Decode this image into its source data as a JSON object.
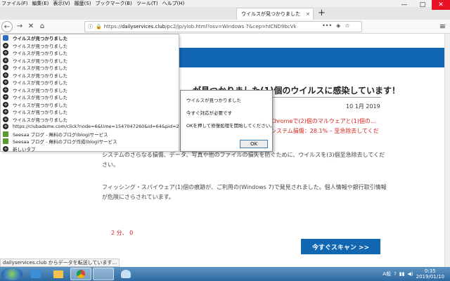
{
  "menubar": [
    "ファイル(F)",
    "編集(E)",
    "表示(V)",
    "履歴(S)",
    "ブックマーク(B)",
    "ツール(T)",
    "ヘルプ(H)"
  ],
  "tab": {
    "title": "ウイルスが見つかりました",
    "close": "×",
    "new": "+"
  },
  "window_controls": {
    "minimize": "—",
    "maximize": "□",
    "close": "✕"
  },
  "nav": {
    "back": "←",
    "forward": "→",
    "stop": "✕",
    "home": "⌂",
    "url_scheme": "https://",
    "url_domain": "dailyservices.club",
    "url_path": "/pc2/jp/ylob.html?osv=Windows 7&cep=hICND9bcVk",
    "menu": "≡"
  },
  "dropdown": {
    "items": [
      {
        "icon": "shield",
        "label": "ウイルスが見つかりました"
      },
      {
        "icon": "plus",
        "label": "ウイルスが見つかりました"
      },
      {
        "icon": "plus",
        "label": "ウイルスが見つかりました"
      },
      {
        "icon": "plus",
        "label": "ウイルスが見つかりました"
      },
      {
        "icon": "plus",
        "label": "ウイルスが見つかりました"
      },
      {
        "icon": "plus",
        "label": "ウイルスが見つかりました"
      },
      {
        "icon": "plus",
        "label": "ウイルスが見つかりました"
      },
      {
        "icon": "plus",
        "label": "ウイルスが見つかりました"
      },
      {
        "icon": "plus",
        "label": "ウイルスが見つかりました"
      },
      {
        "icon": "plus",
        "label": "ウイルスが見つかりました"
      },
      {
        "icon": "plus",
        "label": "ウイルスが見つかりました"
      },
      {
        "icon": "plus",
        "label": "ウイルスが見つかりました"
      },
      {
        "icon": "plus",
        "label": "https://clubadsme.com/click?node=6&time=1547047260&id=64&pid=2..."
      },
      {
        "icon": "book",
        "label": "Seesaa ブログ - 無料のブログ(blog)サービス"
      },
      {
        "icon": "book",
        "label": "Seesaa ブログ - 無料のブログ作成(blog)サービス"
      },
      {
        "icon": "plus",
        "label": "新しいタブ"
      }
    ]
  },
  "page": {
    "headline": "…が見つかりました(1)個のウイルスに感染しています！",
    "date": "10 1月 2019",
    "red_text": "Chromeで(2)個のマルウェアと(1)個の… システム損傷：28.1% – 至急除去してくだ",
    "body1": "システムのさらなる損傷、データ、写真や他のファイルの損失を防ぐために、ウイルスを(3)個至急除去してください。",
    "body2": "フィッシング・スパイウェア(1)個の痕跡が、ご利用の(Windows 7)で発見されました。個人情報や銀行取引情報が危険にさらされています。",
    "timer": "2 分、 0",
    "scan_button": "今すぐスキャン >>"
  },
  "dialog": {
    "line1": "ウイルスが見つかりました",
    "line2": "今すぐ対応が必要です",
    "line3": "OKを押して修復処理を開始してください。",
    "ok": "OK"
  },
  "status": "dailyservices.club からデータを転送しています...",
  "taskbar": {
    "apps": [
      "explorer",
      "firefox",
      "folder",
      "chrome",
      "blank",
      "paint"
    ],
    "tray_lang": "A般",
    "time": "0:35",
    "date": "2019/01/10"
  }
}
